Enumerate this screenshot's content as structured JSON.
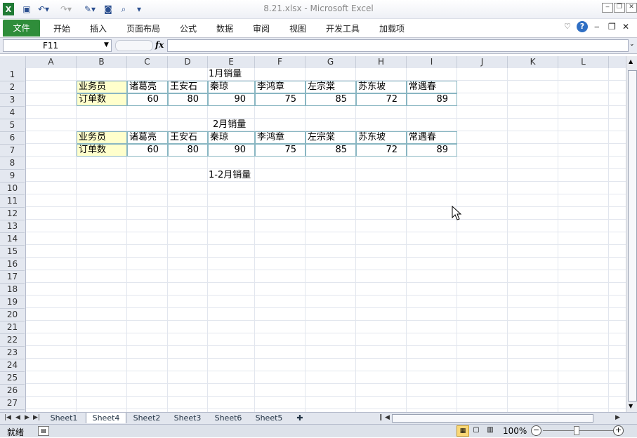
{
  "window": {
    "title": "8.21.xlsx  -  Microsoft Excel"
  },
  "ribbon": {
    "tabs": [
      "文件",
      "开始",
      "插入",
      "页面布局",
      "公式",
      "数据",
      "审阅",
      "视图",
      "开发工具",
      "加载项"
    ]
  },
  "formula_bar": {
    "name_box": "F11",
    "fx_label": "fx",
    "formula": ""
  },
  "columns": [
    "A",
    "B",
    "C",
    "D",
    "E",
    "F",
    "G",
    "H",
    "I",
    "J",
    "K",
    "L"
  ],
  "rows": [
    "1",
    "2",
    "3",
    "4",
    "5",
    "6",
    "7",
    "8",
    "9",
    "10",
    "11",
    "12",
    "13",
    "14",
    "15",
    "16",
    "17",
    "18",
    "19",
    "20",
    "21",
    "22",
    "23",
    "24",
    "25",
    "26",
    "27"
  ],
  "sheet": {
    "title1": "1月销量",
    "title2": "2月销量",
    "title3": "1-2月销量",
    "header_label": "业务员",
    "count_label": "订单数",
    "names": [
      "诸葛亮",
      "王安石",
      "秦琼",
      "李鸿章",
      "左宗棠",
      "苏东坡",
      "常遇春"
    ],
    "jan": [
      "60",
      "80",
      "90",
      "75",
      "85",
      "72",
      "89"
    ],
    "feb": [
      "60",
      "80",
      "90",
      "75",
      "85",
      "72",
      "89"
    ]
  },
  "sheet_tabs": [
    "Sheet1",
    "Sheet4",
    "Sheet2",
    "Sheet3",
    "Sheet6",
    "Sheet5"
  ],
  "active_sheet": "Sheet4",
  "status": {
    "ready": "就绪",
    "zoom": "100%"
  },
  "colors": {
    "accent": "#2f8d3a",
    "header_bg": "#e4e8f0",
    "highlight": "#ffffcc"
  }
}
